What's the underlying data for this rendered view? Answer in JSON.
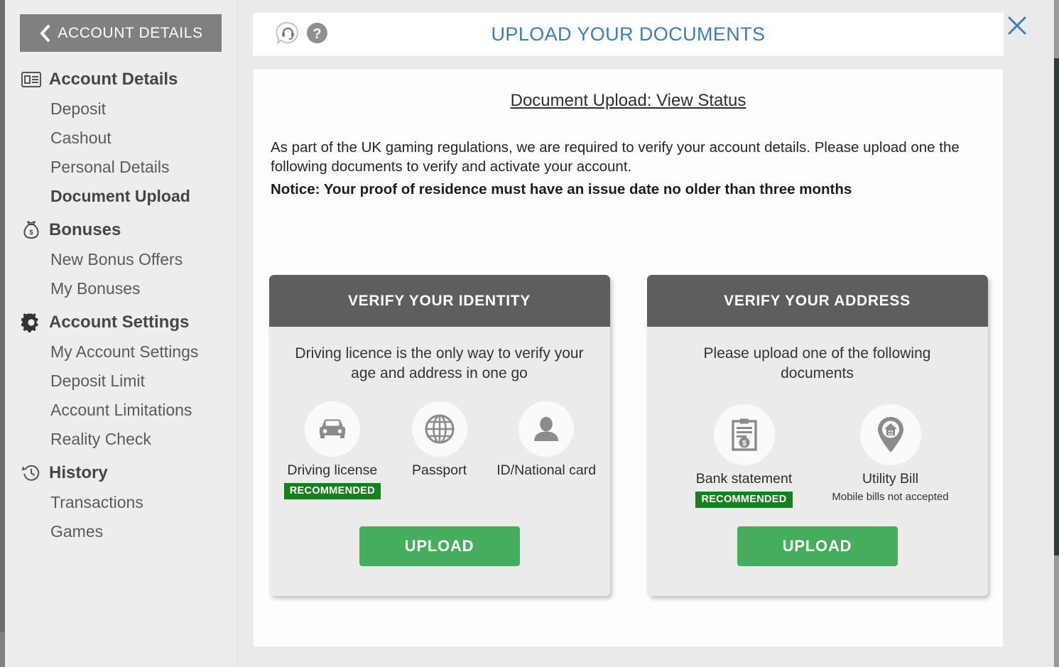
{
  "colors": {
    "accent_blue": "#3d7cba",
    "green_button": "#45ad5c",
    "badge_green": "#14801e",
    "card_header_gray": "#5e5e5e",
    "sidebar_header_gray": "#808080"
  },
  "sidebar": {
    "header_label": "ACCOUNT DETAILS",
    "back_icon": "chevron-left-icon",
    "groups": [
      {
        "label": "Account Details",
        "icon": "id-card-icon",
        "items": [
          {
            "label": "Deposit",
            "active": false
          },
          {
            "label": "Cashout",
            "active": false
          },
          {
            "label": "Personal Details",
            "active": false
          },
          {
            "label": "Document Upload",
            "active": true
          }
        ]
      },
      {
        "label": "Bonuses",
        "icon": "money-bag-icon",
        "items": [
          {
            "label": "New Bonus Offers",
            "active": false
          },
          {
            "label": "My Bonuses",
            "active": false
          }
        ]
      },
      {
        "label": "Account Settings",
        "icon": "gear-icon",
        "items": [
          {
            "label": "My Account Settings",
            "active": false
          },
          {
            "label": "Deposit Limit",
            "active": false
          },
          {
            "label": "Account Limitations",
            "active": false
          },
          {
            "label": "Reality Check",
            "active": false
          }
        ]
      },
      {
        "label": "History",
        "icon": "history-clock-icon",
        "items": [
          {
            "label": "Transactions",
            "active": false
          },
          {
            "label": "Games",
            "active": false
          }
        ]
      }
    ]
  },
  "header": {
    "title": "UPLOAD YOUR DOCUMENTS",
    "support_icon": "headset-support-icon",
    "help_icon": "question-mark-help-icon",
    "close_icon": "close-x-icon"
  },
  "main": {
    "status_link": "Document Upload: View Status",
    "intro": "As part of the UK gaming regulations, we are required to verify your account details. Please upload one the following documents to verify and activate your account.",
    "notice": "Notice: Your proof of residence must have an issue date no older than three months"
  },
  "cards": [
    {
      "title": "VERIFY YOUR IDENTITY",
      "subtitle": "Driving licence is the only way to verify your age and address in one go",
      "options": [
        {
          "label": "Driving license",
          "icon": "car-icon",
          "badge": "RECOMMENDED",
          "note": ""
        },
        {
          "label": "Passport",
          "icon": "globe-icon",
          "badge": "",
          "note": ""
        },
        {
          "label": "ID/National card",
          "icon": "person-icon",
          "badge": "",
          "note": ""
        }
      ],
      "upload_label": "UPLOAD"
    },
    {
      "title": "VERIFY YOUR ADDRESS",
      "subtitle": "Please upload one of the following documents",
      "options": [
        {
          "label": "Bank statement",
          "icon": "clipboard-dollar-icon",
          "badge": "RECOMMENDED",
          "note": ""
        },
        {
          "label": "Utility Bill",
          "icon": "map-pin-house-icon",
          "badge": "",
          "note": "Mobile bills not accepted"
        }
      ],
      "upload_label": "UPLOAD"
    }
  ]
}
